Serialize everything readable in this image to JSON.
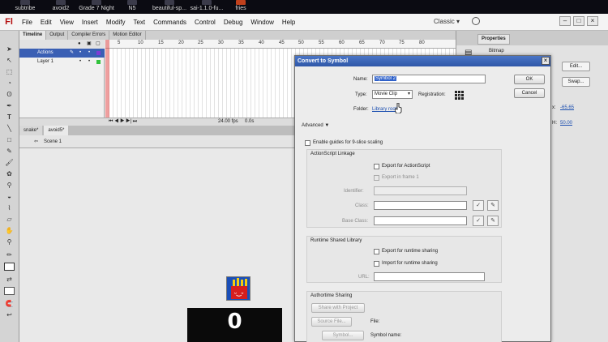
{
  "desktop": {
    "items": [
      "subtribe",
      "avoid2",
      "Grade 7 Night",
      "N5",
      "beautiful-sp...",
      "sai-1.1.0-fu...",
      "fries"
    ]
  },
  "menubar": {
    "logo": "Fl",
    "items": [
      "File",
      "Edit",
      "View",
      "Insert",
      "Modify",
      "Text",
      "Commands",
      "Control",
      "Debug",
      "Window",
      "Help"
    ],
    "workspace": "Classic",
    "workspace_caret": "▾",
    "min": "–",
    "max": "□",
    "close": "×"
  },
  "timeline": {
    "tabs": [
      "Timeline",
      "Output",
      "Compiler Errors",
      "Motion Editor"
    ],
    "layers": [
      {
        "name": "Actions"
      },
      {
        "name": "Layer 1"
      }
    ],
    "ruler": [
      "5",
      "10",
      "15",
      "20",
      "25",
      "30",
      "35",
      "40",
      "45",
      "50",
      "55",
      "60",
      "65",
      "70",
      "75",
      "80"
    ],
    "fps": "24.00 fps",
    "time": "0.0s"
  },
  "doc": {
    "tabs": [
      "snake*",
      "avoid5*"
    ],
    "scene": "Scene 1"
  },
  "stage": {
    "score": "0"
  },
  "properties": {
    "tab": "Properties",
    "symbol_type": "Bitmap",
    "edit": "Edit...",
    "swap": "Swap...",
    "val1": "-65.65",
    "val2": "50.00",
    "lbl1": "x:",
    "lbl2": "H:"
  },
  "dialog": {
    "title": "Convert to Symbol",
    "name_label": "Name:",
    "name_value": "Symbol 2",
    "type_label": "Type:",
    "type_value": "Movie Clip",
    "registration_label": "Registration:",
    "folder_label": "Folder:",
    "folder_value": "Library root",
    "ok": "OK",
    "cancel": "Cancel",
    "advanced": "Advanced ▼",
    "nine_slice": "Enable guides for 9-slice scaling",
    "as_linkage": {
      "header": "ActionScript Linkage",
      "export_as": "Export for ActionScript",
      "export_frame": "Export in frame 1",
      "identifier": "Identifier:",
      "class": "Class:",
      "base_class": "Base Class:"
    },
    "rsl": {
      "header": "Runtime Shared Library",
      "export": "Export for runtime sharing",
      "import": "Import for runtime sharing",
      "url": "URL:"
    },
    "authortime": {
      "header": "Authortime Sharing",
      "share": "Share with Project",
      "source_file_btn": "Source File...",
      "file": "File:",
      "symbol_btn": "Symbol...",
      "symbol_name": "Symbol name:"
    }
  }
}
